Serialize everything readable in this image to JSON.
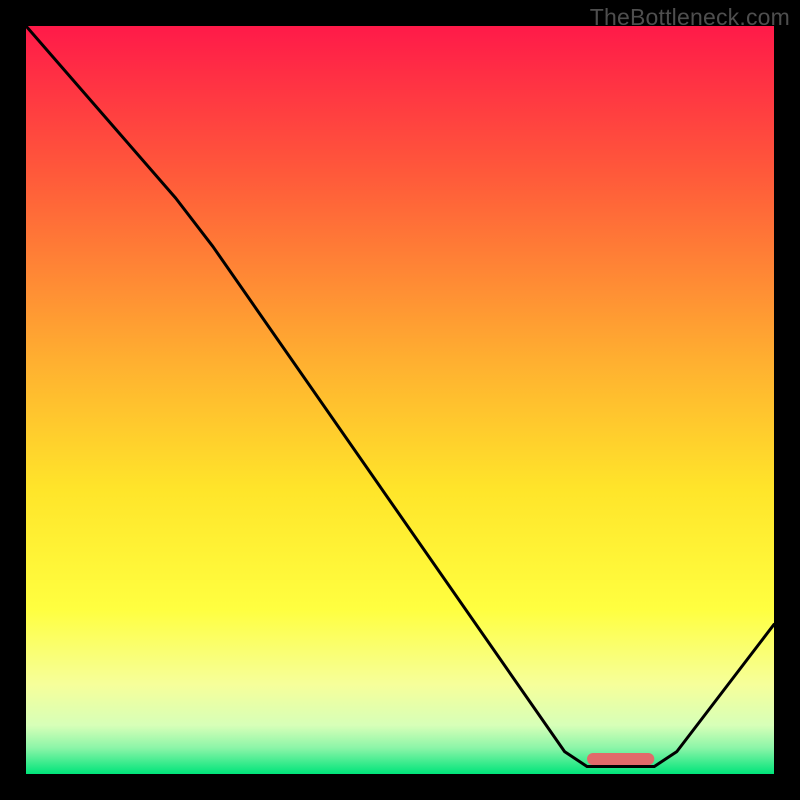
{
  "watermark": "TheBottleneck.com",
  "chart_data": {
    "type": "line",
    "title": "",
    "xlabel": "",
    "ylabel": "",
    "xlim": [
      0,
      100
    ],
    "ylim": [
      0,
      100
    ],
    "gradient_stops": [
      {
        "offset": 0.0,
        "color": "#ff1a49"
      },
      {
        "offset": 0.2,
        "color": "#ff5a3a"
      },
      {
        "offset": 0.45,
        "color": "#ffb030"
      },
      {
        "offset": 0.62,
        "color": "#ffe52a"
      },
      {
        "offset": 0.78,
        "color": "#ffff40"
      },
      {
        "offset": 0.88,
        "color": "#f6ff9a"
      },
      {
        "offset": 0.935,
        "color": "#d7ffb8"
      },
      {
        "offset": 0.965,
        "color": "#8cf5a8"
      },
      {
        "offset": 1.0,
        "color": "#00e47a"
      }
    ],
    "series": [
      {
        "name": "bottleneck-curve",
        "stroke": "#000000",
        "points": [
          {
            "x": 0.0,
            "y": 100.0
          },
          {
            "x": 20.0,
            "y": 77.0
          },
          {
            "x": 25.0,
            "y": 70.5
          },
          {
            "x": 72.0,
            "y": 3.0
          },
          {
            "x": 75.0,
            "y": 1.0
          },
          {
            "x": 84.0,
            "y": 1.0
          },
          {
            "x": 87.0,
            "y": 3.0
          },
          {
            "x": 100.0,
            "y": 20.0
          }
        ]
      }
    ],
    "marker": {
      "name": "optimal-range",
      "color": "#e26a6a",
      "x_start": 75.0,
      "x_end": 84.0,
      "y": 2.0
    }
  }
}
